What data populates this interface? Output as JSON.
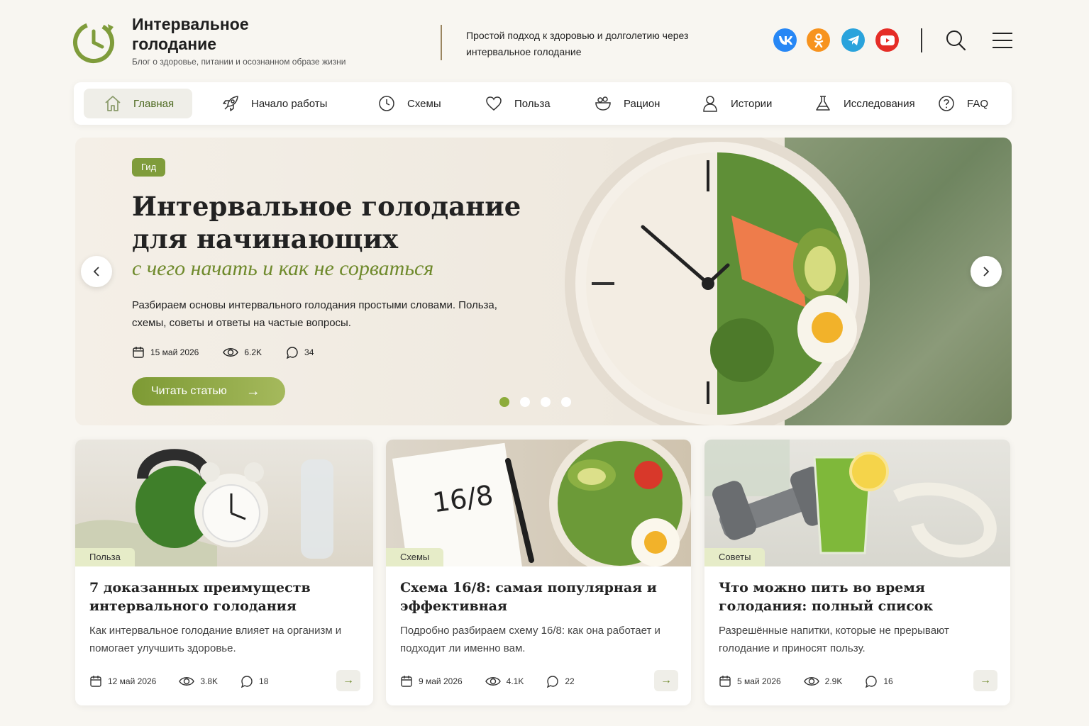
{
  "header": {
    "brand_title": "Интервальное голодание",
    "brand_subtitle": "Блог о здоровье, питании и осознанном образе жизни",
    "tagline": "Простой подход к здоровью и долголетию через интервальное голодание",
    "social": [
      {
        "name": "vk",
        "label": "VK",
        "color": "#2787f5"
      },
      {
        "name": "odnoklassniki",
        "label": "ОК",
        "color": "#f7931e"
      },
      {
        "name": "telegram",
        "label": "TG",
        "color": "#2aa3dc"
      },
      {
        "name": "youtube",
        "label": "YT",
        "color": "#e52d27"
      }
    ]
  },
  "nav": {
    "items": [
      {
        "label": "Главная",
        "icon": "home-icon",
        "active": true
      },
      {
        "label": "Начало работы",
        "icon": "rocket-icon"
      },
      {
        "label": "Схемы",
        "icon": "clock-icon"
      },
      {
        "label": "Польза",
        "icon": "heart-icon"
      },
      {
        "label": "Рацион",
        "icon": "bowl-icon"
      },
      {
        "label": "Истории",
        "icon": "user-icon"
      },
      {
        "label": "Исследования",
        "icon": "flask-icon"
      },
      {
        "label": "FAQ",
        "icon": "question-icon"
      }
    ]
  },
  "hero": {
    "tag": "Гид",
    "title": "Интервальное голодание для начинающих",
    "subtitle": "с чего начать и как не сорваться",
    "description": "Разбираем основы интервального голодания простыми словами. Польза, схемы, советы и ответы на частые вопросы.",
    "date": "15 май 2026",
    "views": "6.2K",
    "comments": "34",
    "button_label": "Читать статью",
    "slides_total": 4,
    "slide_active": 1
  },
  "cards": [
    {
      "tag": "Польза",
      "title": "7 доказанных преимуществ интервального голодания",
      "description": "Как интервальное голодание влияет на организм и помогает улучшить здоровье.",
      "date": "12 май 2026",
      "views": "3.8K",
      "comments": "18"
    },
    {
      "tag": "Схемы",
      "title": "Схема 16/8: самая популярная и эффективная",
      "description": "Подробно разбираем схему 16/8: как она работает и подходит ли именно вам.",
      "date": "9 май 2026",
      "views": "4.1K",
      "comments": "22",
      "notepad_text": "16/8"
    },
    {
      "tag": "Советы",
      "title": "Что можно пить во время голодания: полный список",
      "description": "Разрешённые напитки, которые не прерывают голодание и приносят пользу.",
      "date": "5 май 2026",
      "views": "2.9K",
      "comments": "16"
    }
  ],
  "colors": {
    "accent": "#7f9c3b",
    "background": "#f8f6f1"
  }
}
